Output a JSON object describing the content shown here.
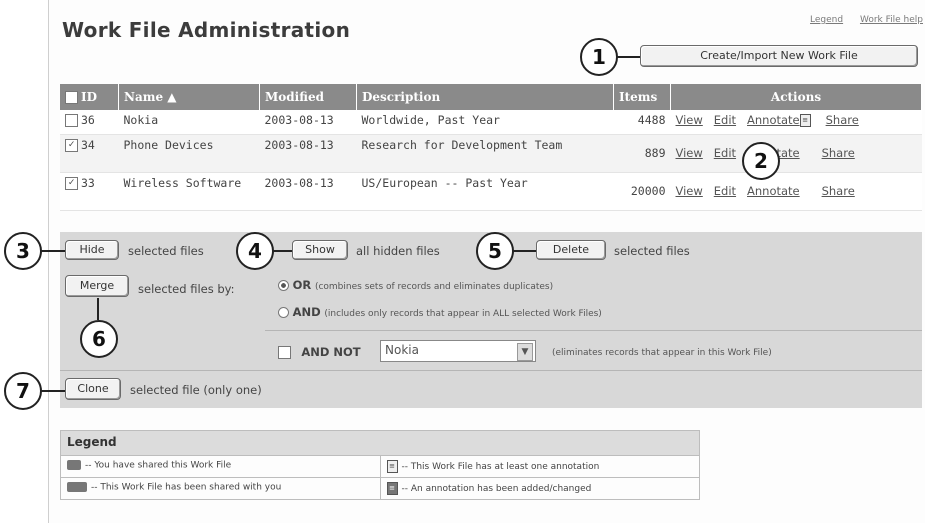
{
  "page": {
    "title": "Work File Administration"
  },
  "toplinks": [
    "Legend",
    "Work File help"
  ],
  "create_button": "Create/Import New Work File",
  "table": {
    "headers": {
      "id": "ID",
      "name": "Name",
      "modified": "Modified",
      "description": "Description",
      "items": "Items",
      "actions": "Actions"
    },
    "rows": [
      {
        "checked": false,
        "id": "36",
        "name": "Nokia",
        "modified": "2003-08-13",
        "description": "Worldwide, Past Year",
        "items": "4488",
        "view": "View",
        "edit": "Edit",
        "annotate": "Annotate",
        "share": "Share"
      },
      {
        "checked": true,
        "id": "34",
        "name": "Phone Devices",
        "modified": "2003-08-13",
        "description": "Research for Development Team",
        "items": "889",
        "view": "View",
        "edit": "Edit",
        "annotate": "Annotate",
        "share": "Share"
      },
      {
        "checked": true,
        "id": "33",
        "name": "Wireless Software",
        "modified": "2003-08-13",
        "description": "US/European -- Past Year",
        "items": "20000",
        "view": "View",
        "edit": "Edit",
        "annotate": "Annotate",
        "share": "Share"
      }
    ]
  },
  "actions": {
    "hide_button": "Hide",
    "hide_text": "selected files",
    "show_button": "Show",
    "show_text": "all hidden files",
    "delete_button": "Delete",
    "delete_text": "selected files",
    "merge_button": "Merge",
    "merge_text": "selected files by:",
    "or_label": "OR",
    "or_desc": "(combines sets of records and eliminates duplicates)",
    "and_label": "AND",
    "and_desc": "(includes only records that appear in ALL selected Work Files)",
    "andnot_label": "AND NOT",
    "andnot_value": "Nokia",
    "andnot_desc": "(eliminates records that appear in this Work File)",
    "clone_button": "Clone",
    "clone_text": "selected file (only one)"
  },
  "legend": {
    "title": "Legend",
    "items": [
      "-- You have shared this Work File",
      "-- This Work File has at least one annotation",
      "-- This Work File has been shared with you",
      "-- An annotation has been added/changed"
    ]
  },
  "callouts": [
    "1",
    "2",
    "3",
    "4",
    "5",
    "6",
    "7"
  ]
}
